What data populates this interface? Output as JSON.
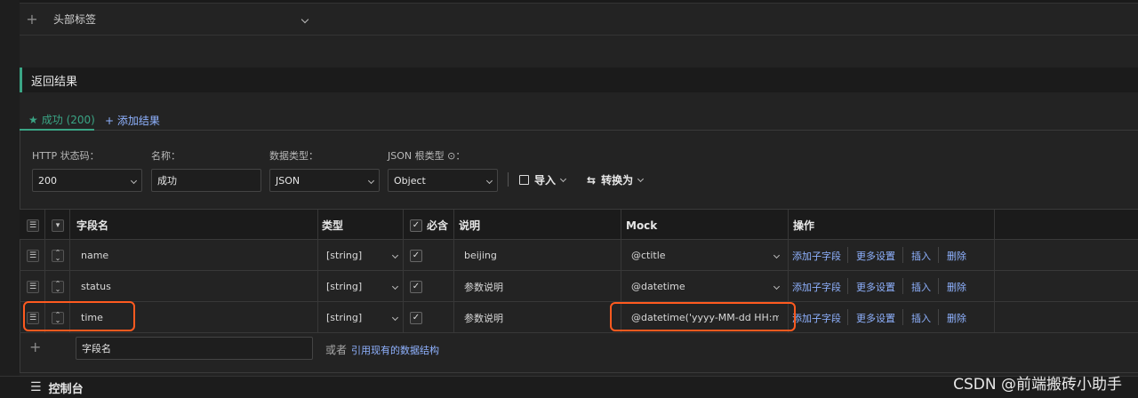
{
  "header_tags": {
    "label": "头部标签"
  },
  "section": {
    "title": "返回结果"
  },
  "tabs": {
    "success": "成功 (200)",
    "add": "+ 添加结果"
  },
  "form": {
    "status_label": "HTTP 状态码：",
    "status_value": "200",
    "name_label": "名称：",
    "name_value": "成功",
    "type_label": "数据类型：",
    "type_value": "JSON",
    "root_label": "JSON 根类型 ⊙：",
    "root_value": "Object",
    "import_label": "导入",
    "convert_label": "转换为"
  },
  "table": {
    "headers": {
      "field": "字段名",
      "type": "类型",
      "required": "必含",
      "desc": "说明",
      "mock": "Mock",
      "ops": "操作"
    },
    "rows": [
      {
        "field": "name",
        "type": "[string]",
        "desc": "beijing",
        "mock": "@ctitle"
      },
      {
        "field": "status",
        "type": "[string]",
        "desc": "参数说明",
        "mock": "@datetime"
      },
      {
        "field": "time",
        "type": "[string]",
        "desc": "参数说明",
        "mock": "@datetime('yyyy-MM-dd HH:mm:s"
      }
    ],
    "ops": {
      "add_child": "添加子字段",
      "more": "更多设置",
      "insert": "插入",
      "delete": "删除"
    },
    "new_field_placeholder": "字段名",
    "or_text": "或者",
    "ref_link": "引用现有的数据结构"
  },
  "bottom": {
    "console": "控制台"
  },
  "watermark": "CSDN @前端搬砖小助手",
  "colors": {
    "accent": "#3aa585",
    "link": "#8fb2ff",
    "highlight": "#ff5a1f"
  }
}
